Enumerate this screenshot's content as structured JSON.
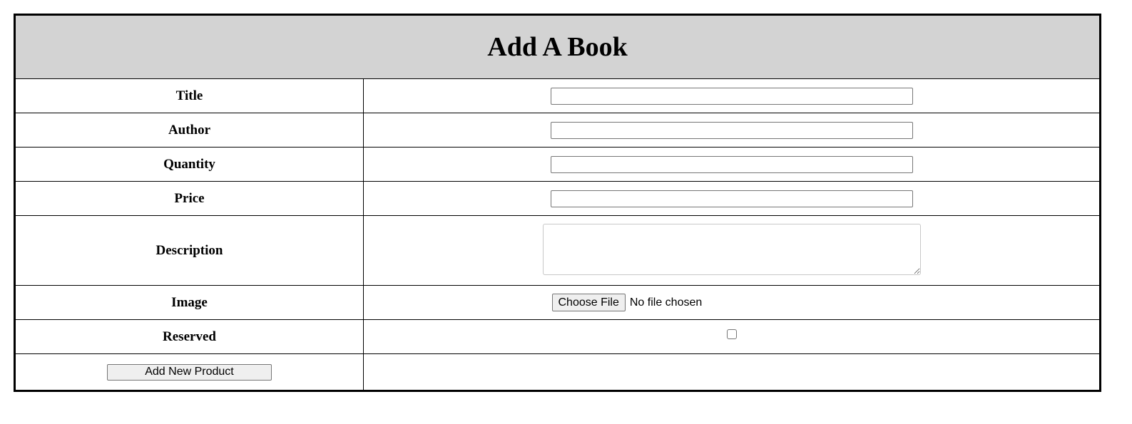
{
  "form": {
    "title": "Add A Book",
    "fields": {
      "title": {
        "label": "Title",
        "value": "",
        "placeholder": ""
      },
      "author": {
        "label": "Author",
        "value": "",
        "placeholder": ""
      },
      "quantity": {
        "label": "Quantity",
        "value": "",
        "placeholder": ""
      },
      "price": {
        "label": "Price",
        "value": "",
        "placeholder": ""
      },
      "description": {
        "label": "Description",
        "value": ""
      },
      "image": {
        "label": "Image",
        "button_label": "Choose File",
        "status": "No file chosen"
      },
      "reserved": {
        "label": "Reserved",
        "checked": false
      }
    },
    "submit_label": "Add New Product"
  },
  "colors": {
    "header_background": "#d3d3d3",
    "border": "#000000"
  }
}
